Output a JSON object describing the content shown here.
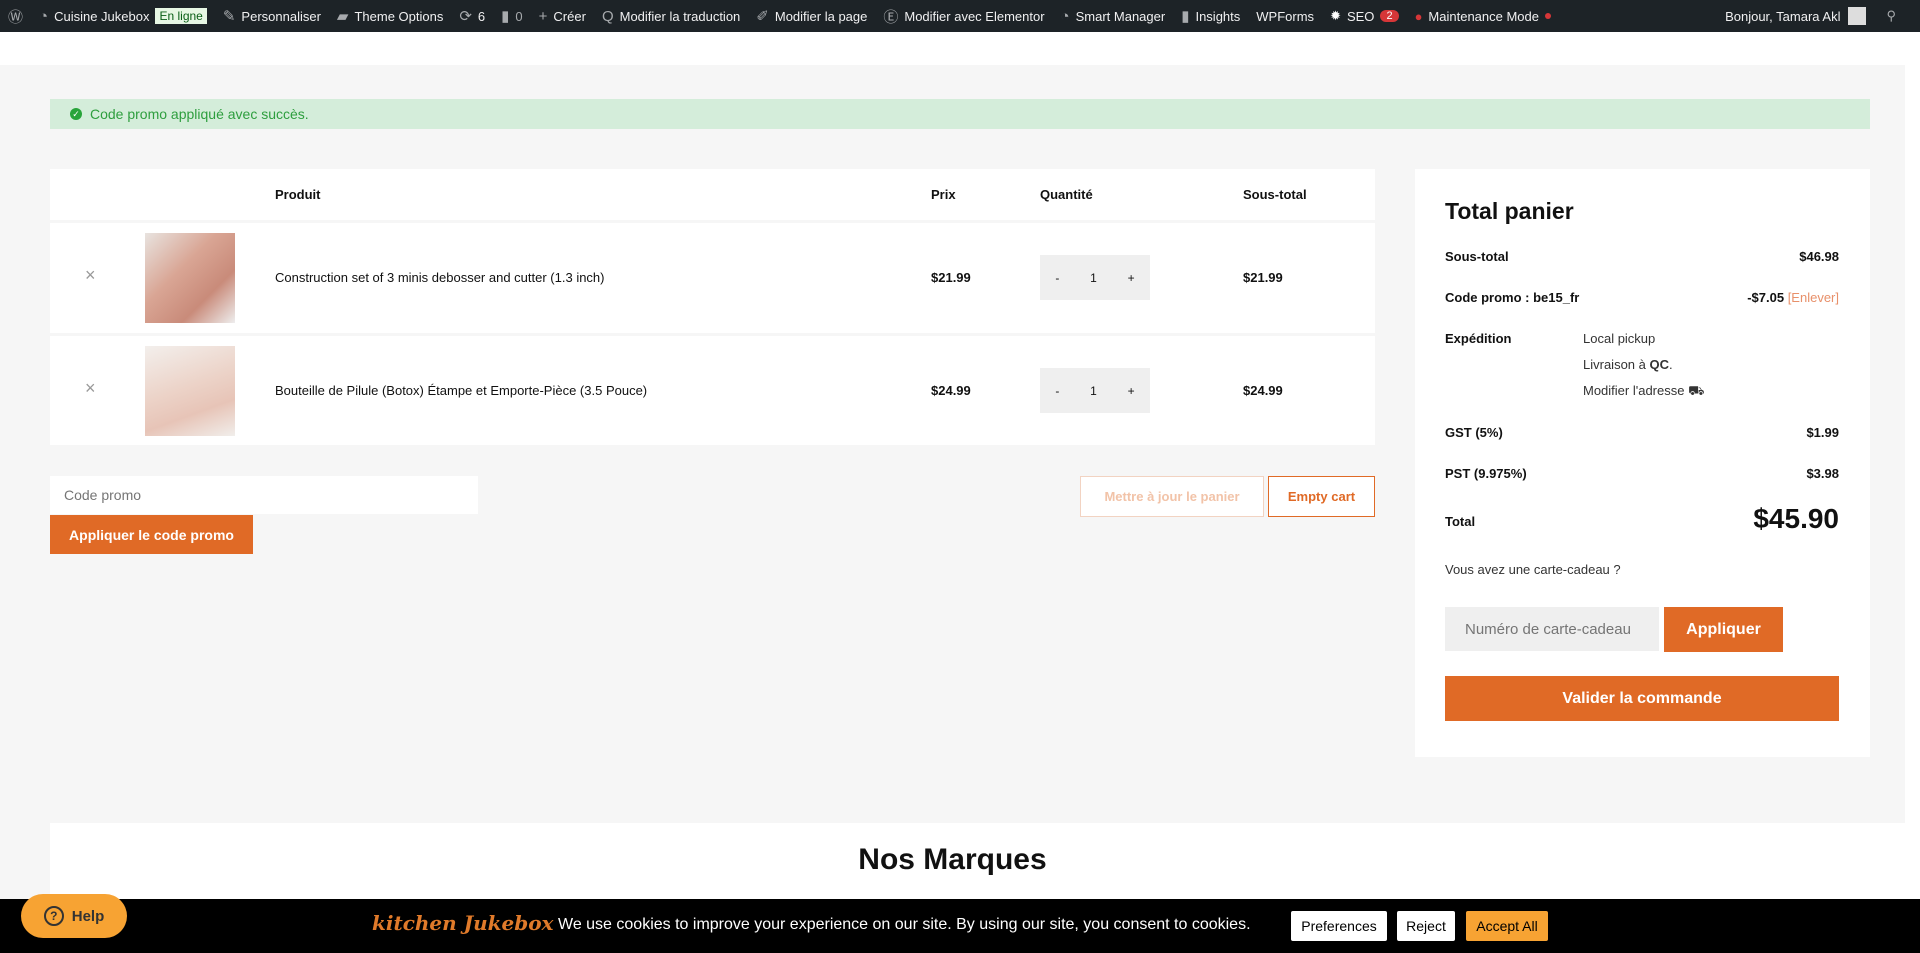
{
  "adminbar": {
    "items": [
      {
        "icon": "wordpress-icon",
        "label": ""
      },
      {
        "icon": "dashboard-icon",
        "label": "Cuisine Jukebox"
      },
      {
        "icon": "",
        "label": "En ligne"
      },
      {
        "icon": "brush-icon",
        "label": "Personnaliser"
      },
      {
        "icon": "folder-icon",
        "label": "Theme Options"
      },
      {
        "icon": "updates-icon",
        "label": "6"
      },
      {
        "icon": "comment-icon",
        "label": "0"
      },
      {
        "icon": "plus-icon",
        "label": "Créer"
      },
      {
        "icon": "translate-icon",
        "label": "Modifier la traduction"
      },
      {
        "icon": "pencil-icon",
        "label": "Modifier la page"
      },
      {
        "icon": "elementor-icon",
        "label": "Modifier avec Elementor"
      },
      {
        "icon": "gauge-icon",
        "label": "Smart Manager"
      },
      {
        "icon": "chart-icon",
        "label": "Insights"
      },
      {
        "icon": "",
        "label": "WPForms"
      },
      {
        "icon": "seo-icon",
        "label": "SEO"
      },
      {
        "icon": "",
        "label": "2"
      },
      {
        "icon": "wrench-icon",
        "label": "Maintenance Mode"
      }
    ],
    "greeting": "Bonjour, Tamara Akl"
  },
  "notice": "Code promo appliqué avec succès.",
  "cart": {
    "headers": {
      "product": "Produit",
      "price": "Prix",
      "qty": "Quantité",
      "subtotal": "Sous-total"
    },
    "items": [
      {
        "name": "Construction set of 3 minis debosser and cutter (1.3 inch)",
        "price": "$21.99",
        "qty": "1",
        "subtotal": "$21.99"
      },
      {
        "name": "Bouteille de Pilule (Botox) Étampe et Emporte-Pièce (3.5 Pouce)",
        "price": "$24.99",
        "qty": "1",
        "subtotal": "$24.99"
      }
    ],
    "minus": "-",
    "plus": "+",
    "remove": "×",
    "coupon_placeholder": "Code promo",
    "apply_coupon": "Appliquer le code promo",
    "update": "Mettre à jour le panier",
    "empty": "Empty cart"
  },
  "totals": {
    "title": "Total panier",
    "subtotal_label": "Sous-total",
    "subtotal": "$46.98",
    "coupon_label": "Code promo : be15_fr",
    "coupon_value": "-$7.05",
    "remove_coupon": "[Enlever]",
    "shipping_label": "Expédition",
    "shipping_method": "Local pickup",
    "shipping_to_prefix": "Livraison à ",
    "shipping_to": "QC",
    "shipping_to_suffix": ".",
    "change_address": "Modifier l'adresse",
    "gst_label": "GST (5%)",
    "gst": "$1.99",
    "pst_label": "PST (9.975%)",
    "pst": "$3.98",
    "total_label": "Total",
    "total": "$45.90",
    "gift_question": "Vous avez une carte-cadeau ?",
    "gift_placeholder": "Numéro de carte-cadeau",
    "gift_apply": "Appliquer",
    "checkout": "Valider la commande"
  },
  "brands_title": "Nos Marques",
  "cookie": {
    "logo": "kitchen Jukebox",
    "text": "We use cookies to improve your experience on our site. By using our site, you consent to cookies.",
    "preferences": "Preferences",
    "reject": "Reject",
    "accept": "Accept All"
  },
  "help": "Help",
  "colors": {
    "accent": "#e06a26",
    "admin_bar": "#1d2327",
    "notice_bg": "#d4edda",
    "help": "#f7a333"
  }
}
